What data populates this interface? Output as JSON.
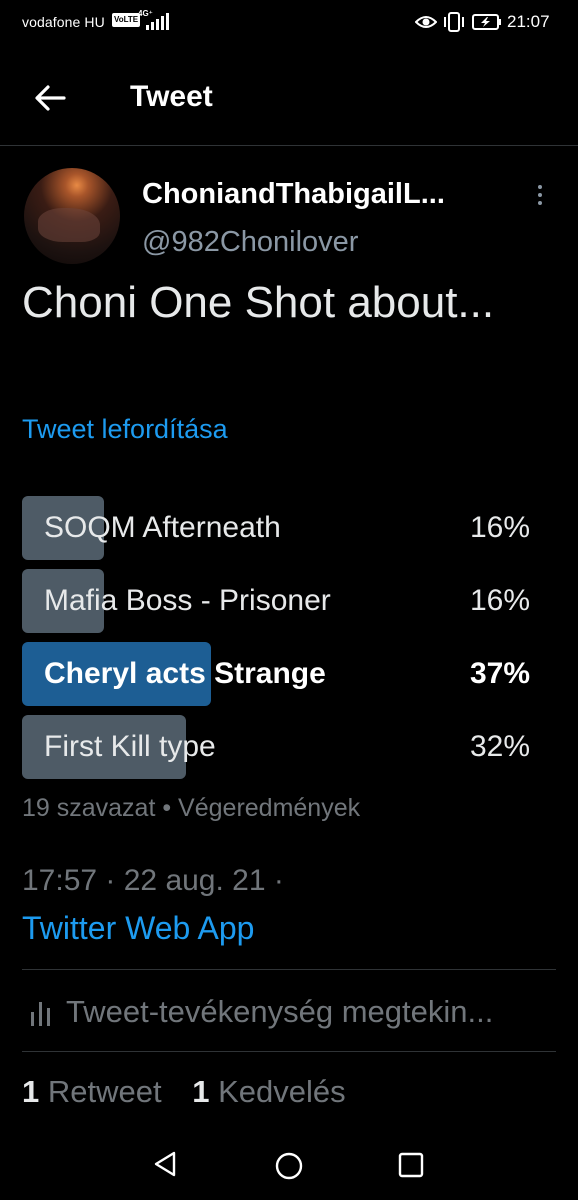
{
  "status_bar": {
    "carrier": "vodafone HU",
    "volte": "VoLTE",
    "network": "4G⁺",
    "time": "21:07",
    "icons": [
      "signal-icon",
      "eye-icon",
      "vibrate-icon",
      "battery-charging-icon"
    ]
  },
  "header": {
    "back_icon": "arrow-left-icon",
    "title": "Tweet"
  },
  "tweet": {
    "author": {
      "display_name": "ChoniandThabigailL...",
      "handle": "@982Chonilover"
    },
    "text": "Choni One Shot about...",
    "translate": "Tweet lefordítása",
    "poll": {
      "options": [
        {
          "label": "SOQM Afterneath",
          "percent": "16%",
          "value": 16
        },
        {
          "label": "Mafia Boss - Prisoner",
          "percent": "16%",
          "value": 16
        },
        {
          "label": "Cheryl acts Strange",
          "percent": "37%",
          "value": 37
        },
        {
          "label": "First Kill type",
          "percent": "32%",
          "value": 32
        }
      ],
      "meta": "19 szavazat • Végeredmények"
    },
    "timestamp": "17:57 · 22 aug. 21 ·",
    "source": "Twitter Web App",
    "activity": "Tweet-tevékenység megtekin...",
    "stats": {
      "retweets_count": "1",
      "retweets_label": "Retweet",
      "likes_count": "1",
      "likes_label": "Kedvelés"
    }
  },
  "nav_bar": {
    "icons": [
      "nav-back-icon",
      "nav-home-icon",
      "nav-recents-icon"
    ]
  },
  "colors": {
    "background": "#000000",
    "accent": "#1d9bf0",
    "secondary_text": "#71767b",
    "poll_bar": "#4e5b66",
    "poll_winner": "#1d5e94"
  }
}
